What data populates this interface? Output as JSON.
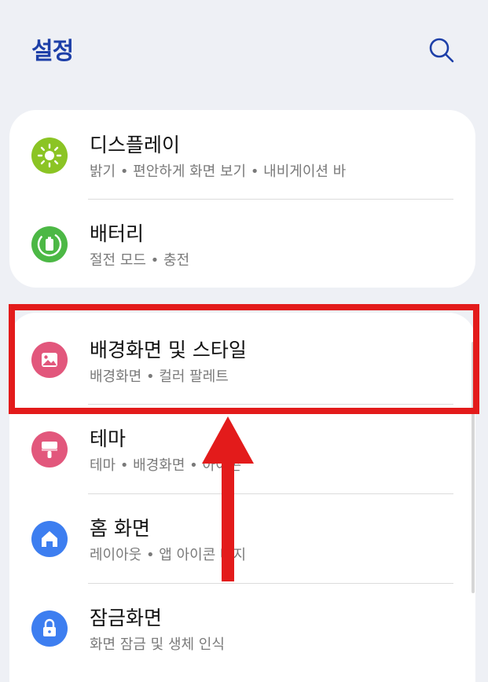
{
  "header": {
    "title": "설정",
    "search_icon": "search-icon"
  },
  "items": [
    {
      "title": "디스플레이",
      "subtitle": "밝기 • 편안하게 화면 보기 • 내비게이션 바",
      "icon": "sun-icon",
      "icon_color": "#8bc424"
    },
    {
      "title": "배터리",
      "subtitle": "절전 모드 • 충전",
      "icon": "battery-icon",
      "icon_color": "#4cb845"
    },
    {
      "title": "배경화면 및 스타일",
      "subtitle": "배경화면 • 컬러 팔레트",
      "icon": "picture-icon",
      "icon_color": "#e2577c"
    },
    {
      "title": "테마",
      "subtitle": "테마 • 배경화면 • 아이콘",
      "icon": "paintbrush-icon",
      "icon_color": "#e2577c"
    },
    {
      "title": "홈 화면",
      "subtitle": "레이아웃 • 앱 아이콘 배지",
      "icon": "home-icon",
      "icon_color": "#3d7ef0"
    },
    {
      "title": "잠금화면",
      "subtitle": "화면 잠금 및 생체 인식",
      "icon": "lock-icon",
      "icon_color": "#3d7ef0"
    }
  ],
  "annotation": {
    "highlight_color": "#e31b1b",
    "highlighted_item": "배경화면 및 스타일"
  }
}
